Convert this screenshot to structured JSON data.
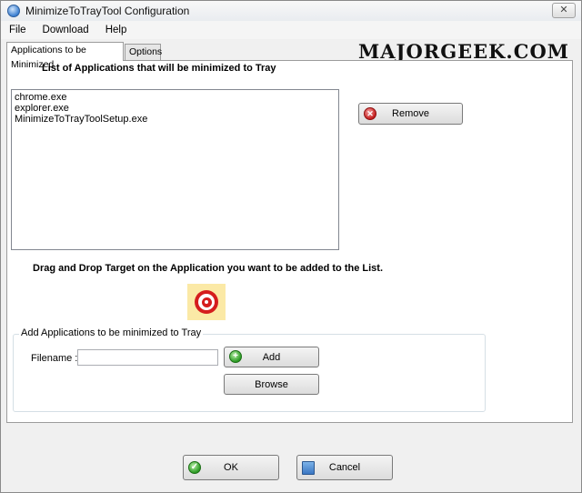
{
  "window": {
    "title": "MinimizeToTrayTool Configuration",
    "close_glyph": "✕"
  },
  "menu": [
    "File",
    "Download",
    "Help"
  ],
  "tabs": {
    "active": "Applications to be Minimized",
    "inactive": "Options"
  },
  "watermark": "MAJORGEEK.COM",
  "list_section": {
    "title": "List of Applications that will be minimized to Tray",
    "items": [
      "chrome.exe",
      "explorer.exe",
      "MinimizeToTrayToolSetup.exe"
    ],
    "remove_label": "Remove",
    "remove_icon": "remove-icon"
  },
  "drag_section": {
    "title": "Drag and Drop Target on the Application you want to be added to the List.",
    "target_icon": "target-icon"
  },
  "add_group": {
    "legend": "Add Applications to be minimized to Tray",
    "filename_label": "Filename :",
    "filename_value": "",
    "add_label": "Add",
    "browse_label": "Browse"
  },
  "footer": {
    "ok_label": "OK",
    "cancel_label": "Cancel"
  },
  "colors": {
    "accent_red": "#d51d1d",
    "accent_green": "#2a9a22",
    "target_bg": "#fbe9a6"
  }
}
